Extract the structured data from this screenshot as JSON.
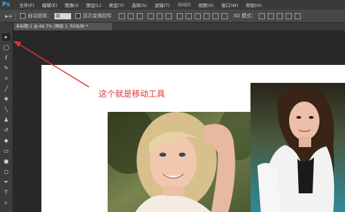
{
  "menubar": {
    "logo": "Ps",
    "items": [
      "文件(F)",
      "编辑(E)",
      "图像(I)",
      "图层(L)",
      "类型(Y)",
      "选择(S)",
      "滤镜(T)",
      "3D(D)",
      "视图(V)",
      "窗口(W)",
      "帮助(H)"
    ]
  },
  "options": {
    "tool_glyph": "▸+",
    "auto_select_label": "自动选择：",
    "auto_select_value": "组",
    "show_transform_label": "显示变换控件",
    "mode_3d_label": "3D 模式："
  },
  "document": {
    "tab_title": "未标题-1 @ 66.7% (图层 1, RGB/8) *"
  },
  "annotation": {
    "text": "这个就是移动工具",
    "color": "#e23232"
  },
  "toolbox": {
    "tools": [
      "move-tool",
      "marquee-tool",
      "lasso-tool",
      "quick-select-tool",
      "crop-tool",
      "eyedropper-tool",
      "healing-tool",
      "brush-tool",
      "stamp-tool",
      "history-brush-tool",
      "eraser-tool",
      "gradient-tool",
      "blur-tool",
      "dodge-tool",
      "pen-tool",
      "type-tool",
      "path-select-tool"
    ]
  }
}
